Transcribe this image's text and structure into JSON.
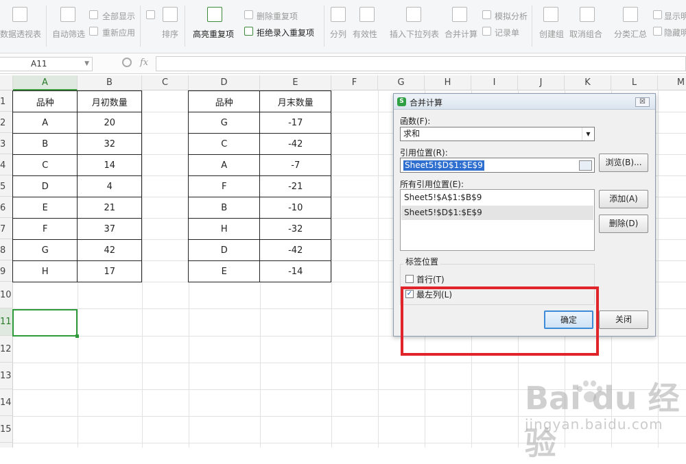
{
  "toolbar": {
    "items": [
      {
        "label": "数据透视表",
        "active": false
      },
      {
        "label": "自动筛选",
        "active": false
      },
      {
        "label": "全部显示",
        "active": false
      },
      {
        "label": "重新应用",
        "active": false
      },
      {
        "label": "排序",
        "active": false
      },
      {
        "label": "高亮重复项",
        "active": true
      },
      {
        "label": "删除重复项",
        "active": false
      },
      {
        "label": "拒绝录入重复项",
        "active": true
      },
      {
        "label": "分列",
        "active": false
      },
      {
        "label": "有效性",
        "active": false
      },
      {
        "label": "插入下拉列表",
        "active": false
      },
      {
        "label": "合并计算",
        "active": false
      },
      {
        "label": "模拟分析",
        "active": false
      },
      {
        "label": "记录单",
        "active": false
      },
      {
        "label": "创建组",
        "active": false
      },
      {
        "label": "取消组合",
        "active": false
      },
      {
        "label": "分类汇总",
        "active": false
      },
      {
        "label": "显示明",
        "active": false
      },
      {
        "label": "隐藏明",
        "active": false
      }
    ]
  },
  "formula_bar": {
    "name_box": "A11",
    "fx": "fx",
    "formula": ""
  },
  "columns": [
    "A",
    "B",
    "C",
    "D",
    "E",
    "F",
    "G",
    "H",
    "I",
    "J",
    "K",
    "L",
    "M"
  ],
  "rows": [
    "1",
    "2",
    "3",
    "4",
    "5",
    "6",
    "7",
    "8",
    "9",
    "10",
    "11",
    "12",
    "13",
    "14",
    "15"
  ],
  "selected_cell": "A11",
  "table1": {
    "headers": [
      "品种",
      "月初数量"
    ],
    "rows": [
      [
        "A",
        "20"
      ],
      [
        "B",
        "32"
      ],
      [
        "C",
        "14"
      ],
      [
        "D",
        "4"
      ],
      [
        "E",
        "21"
      ],
      [
        "F",
        "37"
      ],
      [
        "G",
        "42"
      ],
      [
        "H",
        "17"
      ]
    ]
  },
  "table2": {
    "headers": [
      "品种",
      "月末数量"
    ],
    "rows": [
      [
        "G",
        "-17"
      ],
      [
        "C",
        "-42"
      ],
      [
        "A",
        "-7"
      ],
      [
        "F",
        "-21"
      ],
      [
        "B",
        "-10"
      ],
      [
        "H",
        "-32"
      ],
      [
        "D",
        "-42"
      ],
      [
        "E",
        "-14"
      ]
    ]
  },
  "dialog": {
    "title": "合并计算",
    "close": "☒",
    "function_label": "函数(F):",
    "function_value": "求和",
    "ref_label": "引用位置(R):",
    "ref_value": "Sheet5!$D$1:$E$9",
    "browse": "浏览(B)...",
    "all_refs_label": "所有引用位置(E):",
    "all_refs": [
      "Sheet5!$A$1:$B$9",
      "Sheet5!$D$1:$E$9"
    ],
    "add": "添加(A)",
    "delete": "删除(D)",
    "label_group": "标签位置",
    "top_row": {
      "label": "首行(T)",
      "checked": false
    },
    "left_col": {
      "label": "最左列(L)",
      "checked": true
    },
    "ok": "确定",
    "cancel": "关闭"
  },
  "watermark": {
    "line1": "Bai du 经验",
    "line2": "jingyan.baidu.com"
  },
  "colors": {
    "accent": "#2e9a3a",
    "highlight": "#e0242a",
    "selection": "#2f6fcf"
  }
}
